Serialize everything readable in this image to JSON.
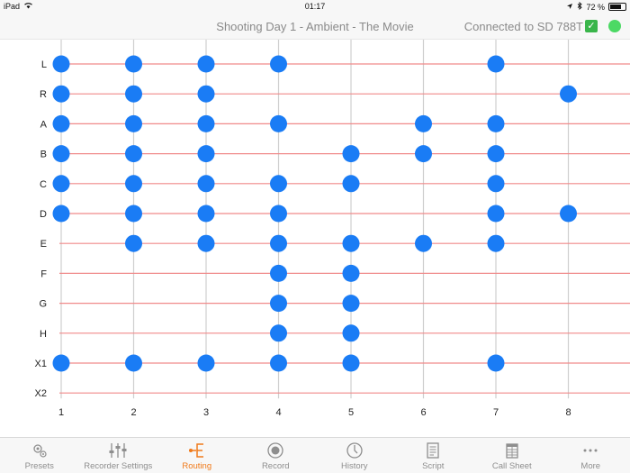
{
  "status_bar": {
    "device": "iPad",
    "time": "01:17",
    "battery_text": "72 %",
    "battery_level": 0.72
  },
  "header": {
    "title": "Shooting Day 1 - Ambient - The Movie",
    "connection": "Connected to SD 788T",
    "connected_color": "#4cd964"
  },
  "routing": {
    "rows": [
      "L",
      "R",
      "A",
      "B",
      "C",
      "D",
      "E",
      "F",
      "G",
      "H",
      "X1",
      "X2"
    ],
    "columns": [
      "1",
      "2",
      "3",
      "4",
      "5",
      "6",
      "7",
      "8"
    ],
    "connections": {
      "L": [
        1,
        2,
        3,
        4,
        7
      ],
      "R": [
        1,
        2,
        3,
        8
      ],
      "A": [
        1,
        2,
        3,
        4,
        6,
        7
      ],
      "B": [
        1,
        2,
        3,
        5,
        6,
        7
      ],
      "C": [
        1,
        2,
        3,
        4,
        5,
        7
      ],
      "D": [
        1,
        2,
        3,
        4,
        7,
        8
      ],
      "E": [
        2,
        3,
        4,
        5,
        6,
        7
      ],
      "F": [
        4,
        5
      ],
      "G": [
        4,
        5
      ],
      "H": [
        4,
        5
      ],
      "X1": [
        1,
        2,
        3,
        4,
        5,
        7
      ],
      "X2": []
    },
    "node_color": "#1a7cf5",
    "row_line_color": "#f08a8a",
    "column_line_color": "#cfcfcf"
  },
  "tabs": [
    {
      "id": "presets",
      "label": "Presets",
      "icon": "gears-icon",
      "active": false
    },
    {
      "id": "recorder",
      "label": "Recorder Settings",
      "icon": "sliders-icon",
      "active": false
    },
    {
      "id": "routing",
      "label": "Routing",
      "icon": "routing-icon",
      "active": true
    },
    {
      "id": "record",
      "label": "Record",
      "icon": "record-icon",
      "active": false
    },
    {
      "id": "history",
      "label": "History",
      "icon": "clock-icon",
      "active": false
    },
    {
      "id": "script",
      "label": "Script",
      "icon": "script-icon",
      "active": false
    },
    {
      "id": "callsheet",
      "label": "Call Sheet",
      "icon": "call-sheet-icon",
      "active": false
    },
    {
      "id": "more",
      "label": "More",
      "icon": "more-icon",
      "active": false
    }
  ]
}
